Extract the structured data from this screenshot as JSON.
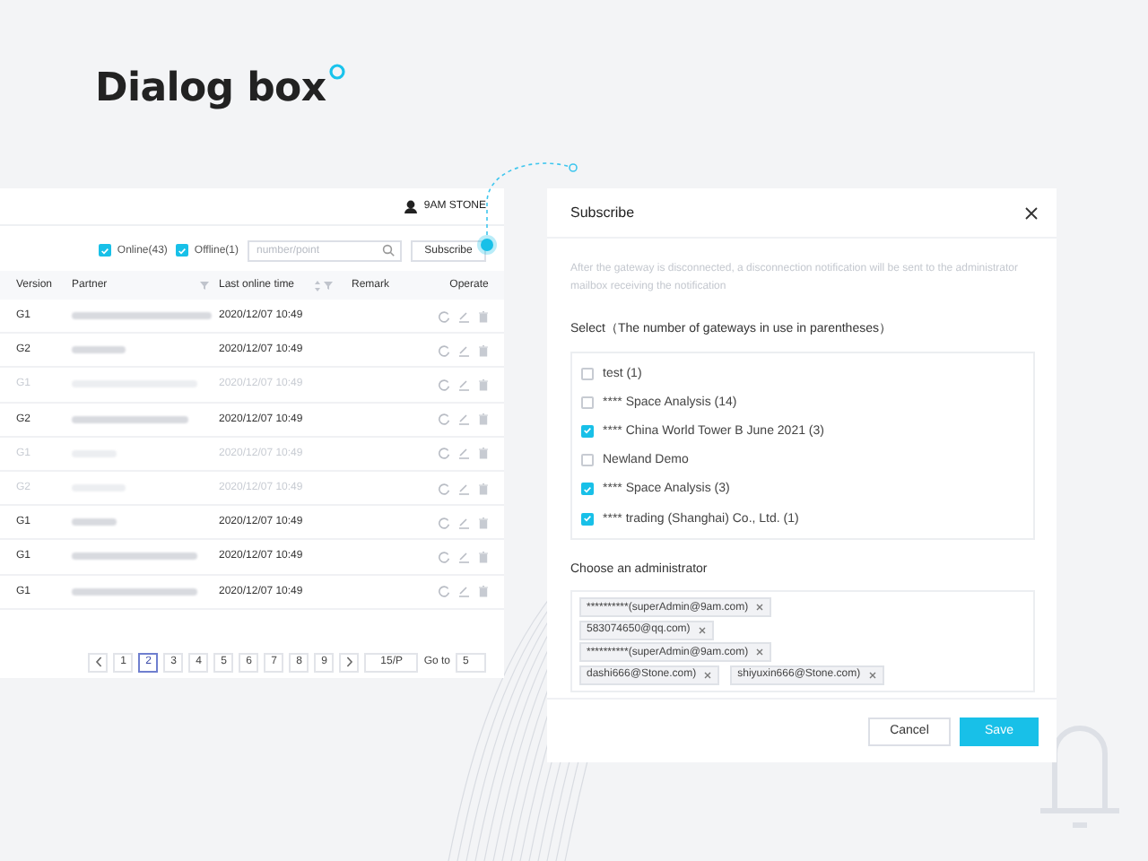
{
  "title": "Dialog box",
  "app": {
    "user": "9AM STONE",
    "filters": [
      {
        "label": "Online(43)",
        "checked": true
      },
      {
        "label": "Offline(1)",
        "checked": true
      }
    ],
    "search": {
      "placeholder": "number/point"
    },
    "subscribe_button": "Subscribe",
    "table": {
      "columns": [
        {
          "label": "Version",
          "kind": "plain"
        },
        {
          "label": "Partner",
          "kind": "filter"
        },
        {
          "label": "Last online time",
          "kind": "sort-filter"
        },
        {
          "label": "Remark",
          "kind": "plain"
        },
        {
          "label": "Operate",
          "kind": "plain"
        }
      ],
      "rows": [
        {
          "version": "G1",
          "time": "2020/12/07 10:49",
          "disabled": false
        },
        {
          "version": "G2",
          "time": "2020/12/07 10:49",
          "disabled": false
        },
        {
          "version": "G1",
          "time": "2020/12/07 10:49",
          "disabled": true
        },
        {
          "version": "G2",
          "time": "2020/12/07 10:49",
          "disabled": false
        },
        {
          "version": "G1",
          "time": "2020/12/07 10:49",
          "disabled": true
        },
        {
          "version": "G2",
          "time": "2020/12/07 10:49",
          "disabled": true
        },
        {
          "version": "G1",
          "time": "2020/12/07 10:49",
          "disabled": false
        },
        {
          "version": "G1",
          "time": "2020/12/07 10:49",
          "disabled": false
        },
        {
          "version": "G1",
          "time": "2020/12/07 10:49",
          "disabled": false
        }
      ]
    },
    "pagination": {
      "pages": [
        {
          "label": "1",
          "selected": false
        },
        {
          "label": "2",
          "selected": true
        },
        {
          "label": "3",
          "selected": false
        },
        {
          "label": "4",
          "selected": false
        },
        {
          "label": "5",
          "selected": false
        },
        {
          "label": "6",
          "selected": false
        },
        {
          "label": "7",
          "selected": false
        },
        {
          "label": "8",
          "selected": false
        },
        {
          "label": "9",
          "selected": false
        }
      ],
      "page_size": "15/P",
      "goto_label": "Go to",
      "goto_value": "5"
    }
  },
  "dialog": {
    "title": "Subscribe",
    "description": "After the gateway is disconnected, a disconnection notification will be sent to the administrator mailbox receiving the notification",
    "select_label": "Select（The number of gateways in use in parentheses）",
    "options": [
      {
        "label": "test  (1)",
        "checked": false
      },
      {
        "label": "**** Space Analysis (14)",
        "checked": false
      },
      {
        "label": "**** China World Tower B June 2021 (3)",
        "checked": true
      },
      {
        "label": "Newland Demo",
        "checked": false
      },
      {
        "label": "**** Space Analysis (3)",
        "checked": true
      },
      {
        "label": "**** trading (Shanghai) Co., Ltd. (1)",
        "checked": true
      }
    ],
    "admin_label": "Choose an administrator",
    "admins": [
      "**********(superAdmin@9am.com)",
      "583074650@qq.com)",
      "**********(superAdmin@9am.com)",
      "dashi666@Stone.com)",
      "shiyuxin666@Stone.com)"
    ],
    "buttons": [
      {
        "label": "Cancel",
        "kind": "default"
      },
      {
        "label": "Save",
        "kind": "primary"
      }
    ]
  }
}
